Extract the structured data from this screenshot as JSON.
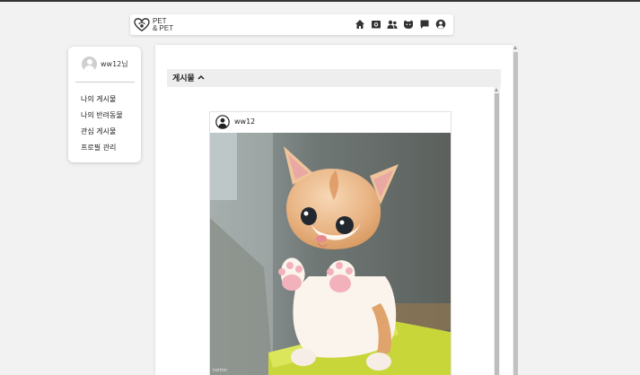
{
  "header": {
    "logo_text_line1": "PET",
    "logo_text_line2": "& PET",
    "nav_icons": [
      "home-icon",
      "photo-icon",
      "people-icon",
      "pets-icon",
      "chat-icon",
      "profile-icon"
    ]
  },
  "sidebar": {
    "username": "ww12님",
    "items": [
      {
        "label": "나의 게시물"
      },
      {
        "label": "나의 반려동물"
      },
      {
        "label": "관심 게시물"
      },
      {
        "label": "프로필 관리"
      }
    ]
  },
  "main": {
    "section_title": "게시물",
    "post": {
      "username": "ww12",
      "image_watermark": "twitter"
    }
  },
  "colors": {
    "background": "#f2f2f2",
    "panel": "#ffffff",
    "section_header": "#eeeeee",
    "icon": "#333333"
  }
}
